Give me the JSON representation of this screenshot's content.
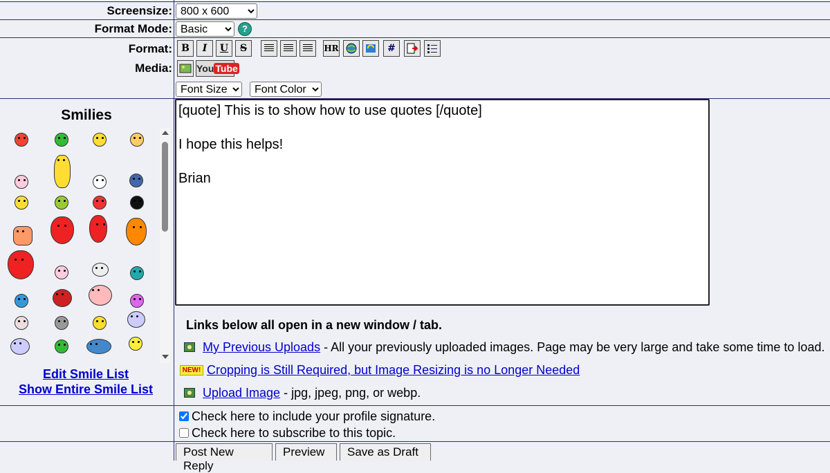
{
  "form": {
    "screensize_label": "Screensize:",
    "screensize_value": "800 x 600",
    "format_mode_label": "Format Mode:",
    "format_mode_value": "Basic",
    "format_label": "Format:",
    "media_label": "Media:",
    "font_size_value": "Font Size",
    "font_color_value": "Font Color"
  },
  "toolbar": {
    "bold": "B",
    "italic": "I",
    "underline": "U",
    "strike": "S",
    "hr": "HR",
    "hash": "#",
    "youtube_you": "You",
    "youtube_tube": "Tube"
  },
  "smilies": {
    "title": "Smilies",
    "edit_link": "Edit Smile List",
    "show_all_link": "Show Entire Smile List"
  },
  "editor": {
    "lines": [
      "[quote] This is to show how to use quotes [/quote]",
      "",
      "I hope this helps!",
      "",
      "Brian"
    ]
  },
  "links": {
    "intro": "Links below all open in a new window / tab.",
    "uploads_link": "My Previous Uploads",
    "uploads_desc": " - All your previously uploaded images. Page may be very large and take some time to load.",
    "new_badge": "NEW!",
    "cropping_link": "Cropping is Still Required, but Image Resizing is no Longer Needed",
    "upload_link": "Upload Image",
    "upload_desc": " - jpg, jpeg, png, or webp."
  },
  "options": {
    "signature_label": "Check here to include your profile signature.",
    "subscribe_label": "Check here to subscribe to this topic."
  },
  "buttons": {
    "post": "Post New Reply",
    "preview": "Preview",
    "draft": "Save as Draft"
  }
}
